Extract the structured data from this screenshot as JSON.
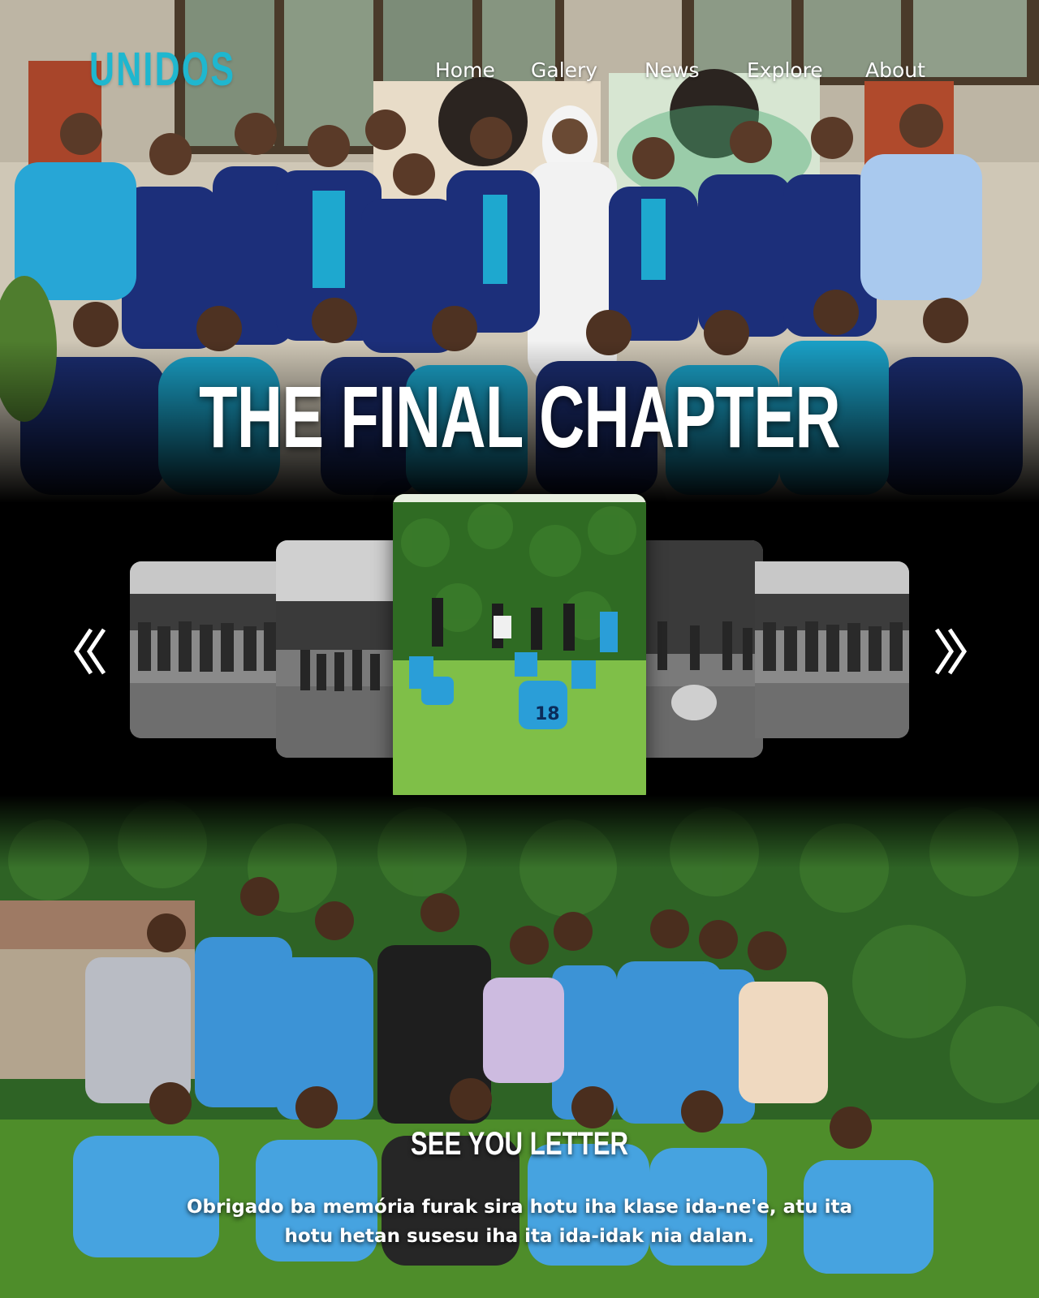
{
  "header": {
    "logo": "UNIDOS",
    "nav": [
      "Home",
      "Galery",
      "News",
      "Explore",
      "About"
    ]
  },
  "hero": {
    "title": "THE FINAL CHAPTER"
  },
  "carousel": {
    "cards": [
      {
        "tone": "grayscale"
      },
      {
        "tone": "grayscale"
      },
      {
        "tone": "color",
        "active": true
      },
      {
        "tone": "grayscale"
      },
      {
        "tone": "grayscale"
      }
    ],
    "prev_icon": "chevrons-left-icon",
    "next_icon": "chevrons-right-icon"
  },
  "closing": {
    "title": "SEE YOU LETTER",
    "message": "Obrigado ba memória furak sira hotu iha klase ida-ne'e, atu ita hotu hetan susesu iha ita ida-idak nia dalan."
  },
  "colors": {
    "brand": "#1fb7cf",
    "page_background": "#000000",
    "text": "#ffffff"
  }
}
